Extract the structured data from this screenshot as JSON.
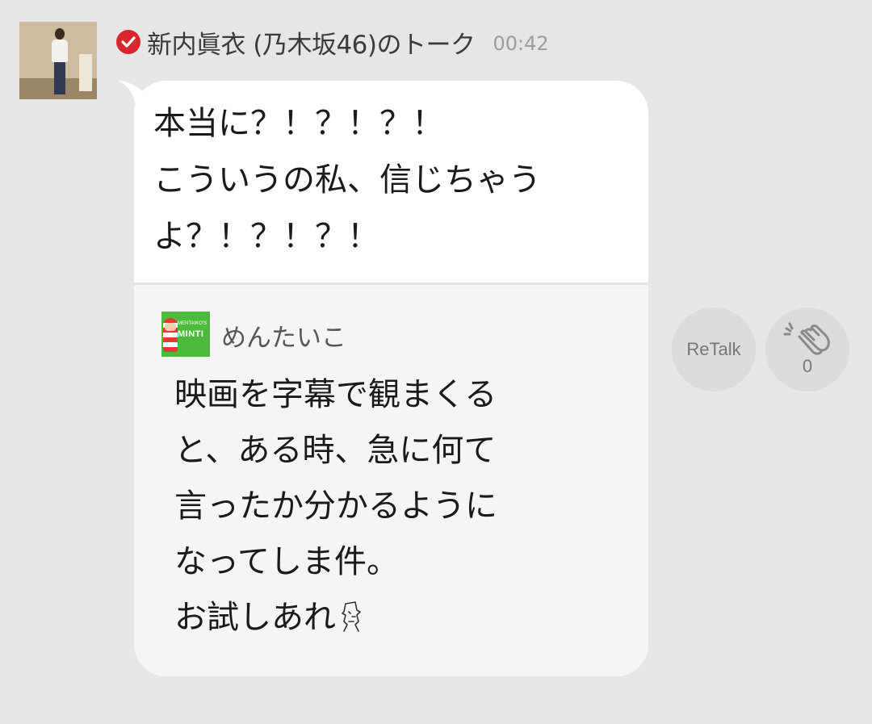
{
  "header": {
    "name": "新内眞衣 (乃木坂46)のトーク",
    "time": "00:42"
  },
  "message": {
    "text": "本当に？！？！？！\nこういうの私、信じちゃう\nよ？！？！？！"
  },
  "quote": {
    "thumb_brand": "MINTI",
    "thumb_small": "MENTAIKO'S",
    "author": "めんたいこ",
    "text": "映画を字幕で観まくる\nと、ある時、急に何て\n言ったか分かるように\nなってしま件。\nお試しあれ"
  },
  "actions": {
    "retalk_label": "ReTalk",
    "clap_count": "0"
  },
  "icons": {
    "verified": "verified-check-icon",
    "clap": "clap-icon",
    "moai": "moai-emoji-icon"
  },
  "colors": {
    "background": "#e6e6e6",
    "bubble": "#ffffff",
    "quote_bg": "#f5f5f5",
    "verified_badge": "#d7282f",
    "thumb_green": "#4cbb3c"
  }
}
